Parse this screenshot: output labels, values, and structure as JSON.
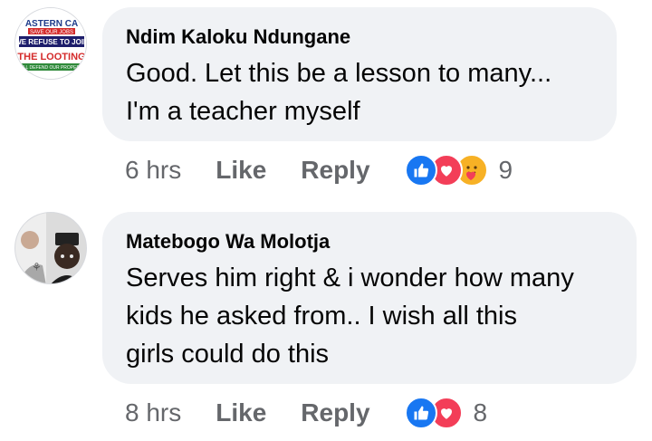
{
  "comments": [
    {
      "author": "Ndim Kaloku Ndungane",
      "lines": [
        "Good. Let this be a lesson to many...",
        "I'm a teacher myself"
      ],
      "time": "6 hrs",
      "like_label": "Like",
      "reply_label": "Reply",
      "reactions": [
        "like-icon",
        "love-icon",
        "care-icon"
      ],
      "reaction_count": "9",
      "avatar_lines": [
        "ASTERN CA",
        "SAVE OUR JOBS",
        "WE REFUSE TO JOIN",
        "THE LOOTING",
        "WILL DEFEND OUR PROPERTY"
      ]
    },
    {
      "author": "Matebogo Wa Molotja",
      "lines": [
        "Serves him right & i wonder how many",
        "kids he asked from.. I wish all this",
        "girls could do this"
      ],
      "time": "8 hrs",
      "like_label": "Like",
      "reply_label": "Reply",
      "reactions": [
        "like-icon",
        "love-icon"
      ],
      "reaction_count": "8"
    }
  ],
  "colors": {
    "bubble": "#f0f2f5",
    "meta_text": "#65676b",
    "like_blue": "#1877f2",
    "love_red": "#f33e58",
    "care_yellow": "#f7b125"
  }
}
